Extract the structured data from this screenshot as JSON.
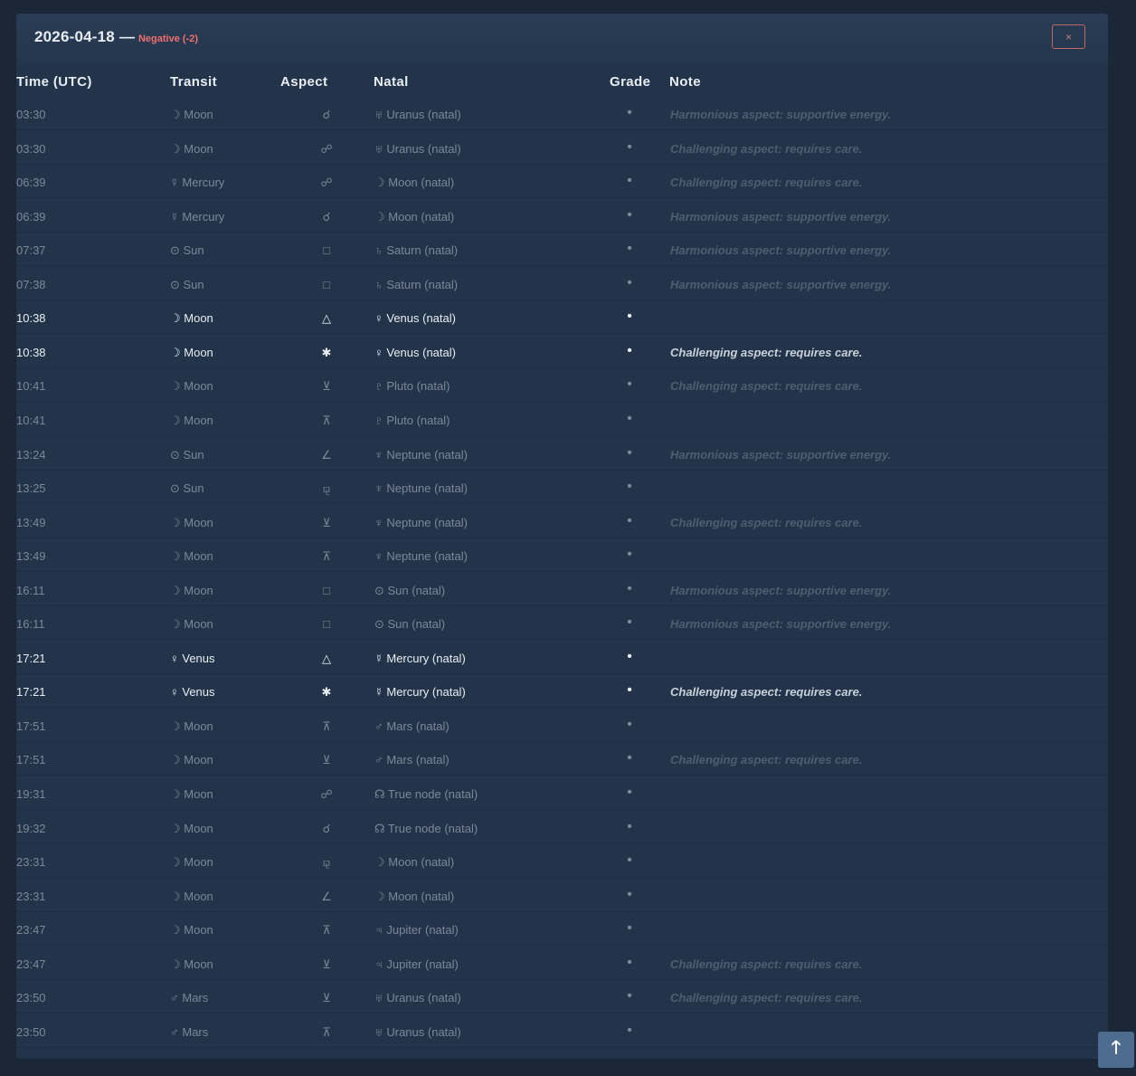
{
  "header": {
    "date": "2026-04-18",
    "separator": "—",
    "status": "Negative (-2)",
    "close_label": "×"
  },
  "columns": [
    "Time (UTC)",
    "Transit",
    "Aspect",
    "Natal",
    "Grade",
    "Note"
  ],
  "rows": [
    {
      "time": "03:30",
      "transit": "☽ Moon",
      "aspect": "☌",
      "natal": "♅ Uranus (natal)",
      "grade": "•",
      "note": "Harmonious aspect: supportive energy.",
      "highlight": false
    },
    {
      "time": "03:30",
      "transit": "☽ Moon",
      "aspect": "☍",
      "natal": "♅ Uranus (natal)",
      "grade": "•",
      "note": "Challenging aspect: requires care.",
      "highlight": false
    },
    {
      "time": "06:39",
      "transit": "☿ Mercury",
      "aspect": "☍",
      "natal": "☽ Moon (natal)",
      "grade": "•",
      "note": "Challenging aspect: requires care.",
      "highlight": false
    },
    {
      "time": "06:39",
      "transit": "☿ Mercury",
      "aspect": "☌",
      "natal": "☽ Moon (natal)",
      "grade": "•",
      "note": "Harmonious aspect: supportive energy.",
      "highlight": false
    },
    {
      "time": "07:37",
      "transit": "⊙ Sun",
      "aspect": "□",
      "natal": "♄ Saturn (natal)",
      "grade": "•",
      "note": "Harmonious aspect: supportive energy.",
      "highlight": false
    },
    {
      "time": "07:38",
      "transit": "⊙ Sun",
      "aspect": "□",
      "natal": "♄ Saturn (natal)",
      "grade": "•",
      "note": "Harmonious aspect: supportive energy.",
      "highlight": false
    },
    {
      "time": "10:38",
      "transit": "☽ Moon",
      "aspect": "△",
      "natal": "♀ Venus (natal)",
      "grade": "•",
      "note": "",
      "highlight": true
    },
    {
      "time": "10:38",
      "transit": "☽ Moon",
      "aspect": "✱",
      "natal": "♀ Venus (natal)",
      "grade": "•",
      "note": "Challenging aspect: requires care.",
      "highlight": true
    },
    {
      "time": "10:41",
      "transit": "☽ Moon",
      "aspect": "⊻",
      "natal": "♇ Pluto (natal)",
      "grade": "•",
      "note": "Challenging aspect: requires care.",
      "highlight": false
    },
    {
      "time": "10:41",
      "transit": "☽ Moon",
      "aspect": "⊼",
      "natal": "♇ Pluto (natal)",
      "grade": "•",
      "note": "",
      "highlight": false
    },
    {
      "time": "13:24",
      "transit": "⊙ Sun",
      "aspect": "∠",
      "natal": "♆ Neptune (natal)",
      "grade": "•",
      "note": "Harmonious aspect: supportive energy.",
      "highlight": false
    },
    {
      "time": "13:25",
      "transit": "⊙ Sun",
      "aspect": "⚼",
      "natal": "♆ Neptune (natal)",
      "grade": "•",
      "note": "",
      "highlight": false
    },
    {
      "time": "13:49",
      "transit": "☽ Moon",
      "aspect": "⊻",
      "natal": "♆ Neptune (natal)",
      "grade": "•",
      "note": "Challenging aspect: requires care.",
      "highlight": false
    },
    {
      "time": "13:49",
      "transit": "☽ Moon",
      "aspect": "⊼",
      "natal": "♆ Neptune (natal)",
      "grade": "•",
      "note": "",
      "highlight": false
    },
    {
      "time": "16:11",
      "transit": "☽ Moon",
      "aspect": "□",
      "natal": "⊙ Sun (natal)",
      "grade": "•",
      "note": "Harmonious aspect: supportive energy.",
      "highlight": false
    },
    {
      "time": "16:11",
      "transit": "☽ Moon",
      "aspect": "□",
      "natal": "⊙ Sun (natal)",
      "grade": "•",
      "note": "Harmonious aspect: supportive energy.",
      "highlight": false
    },
    {
      "time": "17:21",
      "transit": "♀ Venus",
      "aspect": "△",
      "natal": "☿ Mercury (natal)",
      "grade": "•",
      "note": "",
      "highlight": true
    },
    {
      "time": "17:21",
      "transit": "♀ Venus",
      "aspect": "✱",
      "natal": "☿ Mercury (natal)",
      "grade": "•",
      "note": "Challenging aspect: requires care.",
      "highlight": true
    },
    {
      "time": "17:51",
      "transit": "☽ Moon",
      "aspect": "⊼",
      "natal": "♂ Mars (natal)",
      "grade": "•",
      "note": "",
      "highlight": false
    },
    {
      "time": "17:51",
      "transit": "☽ Moon",
      "aspect": "⊻",
      "natal": "♂ Mars (natal)",
      "grade": "•",
      "note": "Challenging aspect: requires care.",
      "highlight": false
    },
    {
      "time": "19:31",
      "transit": "☽ Moon",
      "aspect": "☍",
      "natal": "☊ True node (natal)",
      "grade": "•",
      "note": "",
      "highlight": false
    },
    {
      "time": "19:32",
      "transit": "☽ Moon",
      "aspect": "☌",
      "natal": "☊ True node (natal)",
      "grade": "•",
      "note": "",
      "highlight": false
    },
    {
      "time": "23:31",
      "transit": "☽ Moon",
      "aspect": "⚼",
      "natal": "☽ Moon (natal)",
      "grade": "•",
      "note": "",
      "highlight": false
    },
    {
      "time": "23:31",
      "transit": "☽ Moon",
      "aspect": "∠",
      "natal": "☽ Moon (natal)",
      "grade": "•",
      "note": "",
      "highlight": false
    },
    {
      "time": "23:47",
      "transit": "☽ Moon",
      "aspect": "⊼",
      "natal": "♃ Jupiter (natal)",
      "grade": "•",
      "note": "",
      "highlight": false
    },
    {
      "time": "23:47",
      "transit": "☽ Moon",
      "aspect": "⊻",
      "natal": "♃ Jupiter (natal)",
      "grade": "•",
      "note": "Challenging aspect: requires care.",
      "highlight": false
    },
    {
      "time": "23:50",
      "transit": "♂ Mars",
      "aspect": "⊻",
      "natal": "♅ Uranus (natal)",
      "grade": "•",
      "note": "Challenging aspect: requires care.",
      "highlight": false
    },
    {
      "time": "23:50",
      "transit": "♂ Mars",
      "aspect": "⊼",
      "natal": "♅ Uranus (natal)",
      "grade": "•",
      "note": "",
      "highlight": false
    }
  ],
  "scroll_top_label": "🡑",
  "colors": {
    "background": "#1b2636",
    "panel": "#23344a",
    "negative": "#ef6f6f",
    "scroll_button": "#4e6b90"
  }
}
